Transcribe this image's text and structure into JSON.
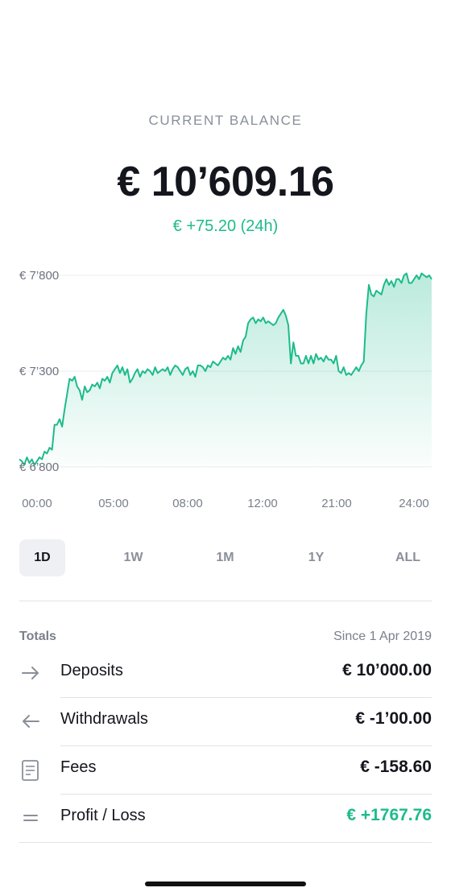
{
  "balance": {
    "label": "CURRENT BALANCE",
    "amount": "€ 10’609.16",
    "change": "€ +75.20 (24h)"
  },
  "chart_data": {
    "type": "area",
    "y_tick_labels": [
      "€ 7’800",
      "€ 7’300",
      "€ 6’800"
    ],
    "y_ticks": [
      7800,
      7300,
      6800
    ],
    "ylim": [
      6800,
      7800
    ],
    "x_tick_labels": [
      "00:00",
      "05:00",
      "08:00",
      "12:00",
      "21:00",
      "24:00"
    ],
    "values": [
      6840,
      6830,
      6810,
      6850,
      6820,
      6840,
      6810,
      6830,
      6850,
      6840,
      6880,
      6870,
      6900,
      6890,
      7020,
      7020,
      7050,
      7010,
      7100,
      7180,
      7260,
      7250,
      7270,
      7220,
      7200,
      7150,
      7220,
      7190,
      7200,
      7230,
      7220,
      7240,
      7210,
      7260,
      7250,
      7270,
      7240,
      7290,
      7310,
      7330,
      7290,
      7320,
      7280,
      7310,
      7240,
      7260,
      7290,
      7310,
      7270,
      7300,
      7290,
      7310,
      7300,
      7280,
      7320,
      7290,
      7300,
      7310,
      7300,
      7320,
      7280,
      7310,
      7330,
      7320,
      7300,
      7280,
      7310,
      7320,
      7280,
      7300,
      7270,
      7330,
      7330,
      7320,
      7300,
      7330,
      7320,
      7350,
      7340,
      7330,
      7350,
      7370,
      7360,
      7380,
      7360,
      7420,
      7390,
      7430,
      7400,
      7460,
      7480,
      7550,
      7570,
      7580,
      7550,
      7570,
      7560,
      7580,
      7550,
      7560,
      7550,
      7540,
      7550,
      7580,
      7600,
      7620,
      7590,
      7540,
      7340,
      7450,
      7380,
      7380,
      7340,
      7340,
      7380,
      7340,
      7380,
      7340,
      7390,
      7360,
      7370,
      7350,
      7380,
      7360,
      7360,
      7340,
      7380,
      7300,
      7290,
      7320,
      7280,
      7290,
      7280,
      7300,
      7320,
      7300,
      7330,
      7350,
      7600,
      7750,
      7700,
      7690,
      7720,
      7710,
      7700,
      7750,
      7780,
      7750,
      7770,
      7740,
      7780,
      7780,
      7760,
      7800,
      7810,
      7760,
      7760,
      7780,
      7800,
      7780,
      7810,
      7800,
      7790,
      7800,
      7780
    ],
    "grid": true,
    "color": "#1dbb8b"
  },
  "ranges": [
    {
      "label": "1D",
      "active": true
    },
    {
      "label": "1W",
      "active": false
    },
    {
      "label": "1M",
      "active": false
    },
    {
      "label": "1Y",
      "active": false
    },
    {
      "label": "ALL",
      "active": false
    }
  ],
  "totals": {
    "label": "Totals",
    "since": "Since 1 Apr 2019",
    "rows": [
      {
        "icon": "arrow-right-icon",
        "label": "Deposits",
        "value": "€ 10’000.00"
      },
      {
        "icon": "arrow-left-icon",
        "label": "Withdrawals",
        "value": "€ -1’00.00"
      },
      {
        "icon": "receipt-icon",
        "label": "Fees",
        "value": "€ -158.60"
      },
      {
        "icon": "equals-icon",
        "label": "Profit / Loss",
        "value": "€ +1767.76"
      }
    ]
  }
}
